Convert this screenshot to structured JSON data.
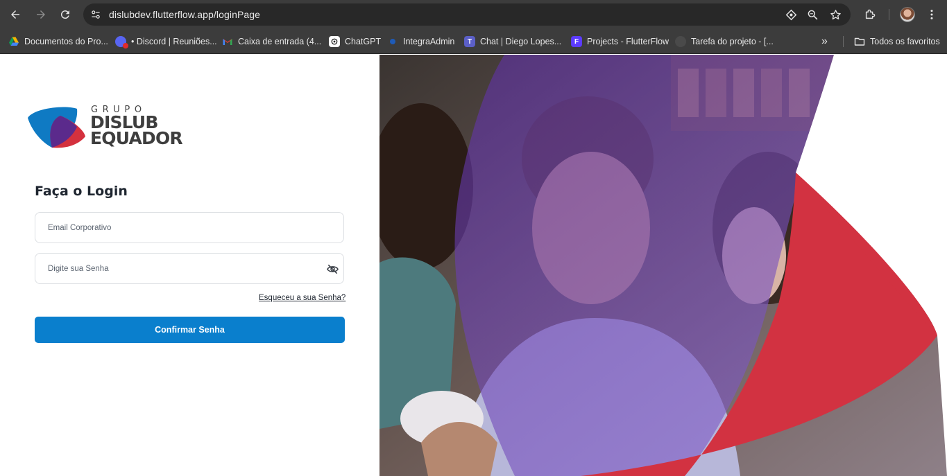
{
  "browser": {
    "url": "dislubdev.flutterflow.app/loginPage",
    "bookmarks": [
      {
        "label": "Documentos do Pro...",
        "icon": "google-drive-icon"
      },
      {
        "label": "• Discord | Reuniões...",
        "icon": "discord-icon"
      },
      {
        "label": "Caixa de entrada (4...",
        "icon": "gmail-icon"
      },
      {
        "label": "ChatGPT",
        "icon": "chatgpt-icon"
      },
      {
        "label": "IntegraAdmin",
        "icon": "globe-dot-icon"
      },
      {
        "label": "Chat | Diego Lopes...",
        "icon": "teams-icon"
      },
      {
        "label": "Projects - FlutterFlow",
        "icon": "flutterflow-icon"
      },
      {
        "label": "Tarefa do projeto - [...",
        "icon": "page-icon"
      }
    ],
    "overflow_label": "»",
    "all_bookmarks_label": "Todos os favoritos"
  },
  "brand": {
    "line1": "GRUPO",
    "line2": "DISLUB",
    "line3": "EQUADOR",
    "colors": {
      "blue": "#0f7ac3",
      "purple": "#5b2a8c",
      "red": "#d4313e"
    }
  },
  "login": {
    "title": "Faça o Login",
    "email_placeholder": "Email Corporativo",
    "password_placeholder": "Digite sua Senha",
    "forgot_label": "Esqueceu a sua Senha?",
    "confirm_label": "Confirmar Senha",
    "accent": "#0a7fcd"
  }
}
